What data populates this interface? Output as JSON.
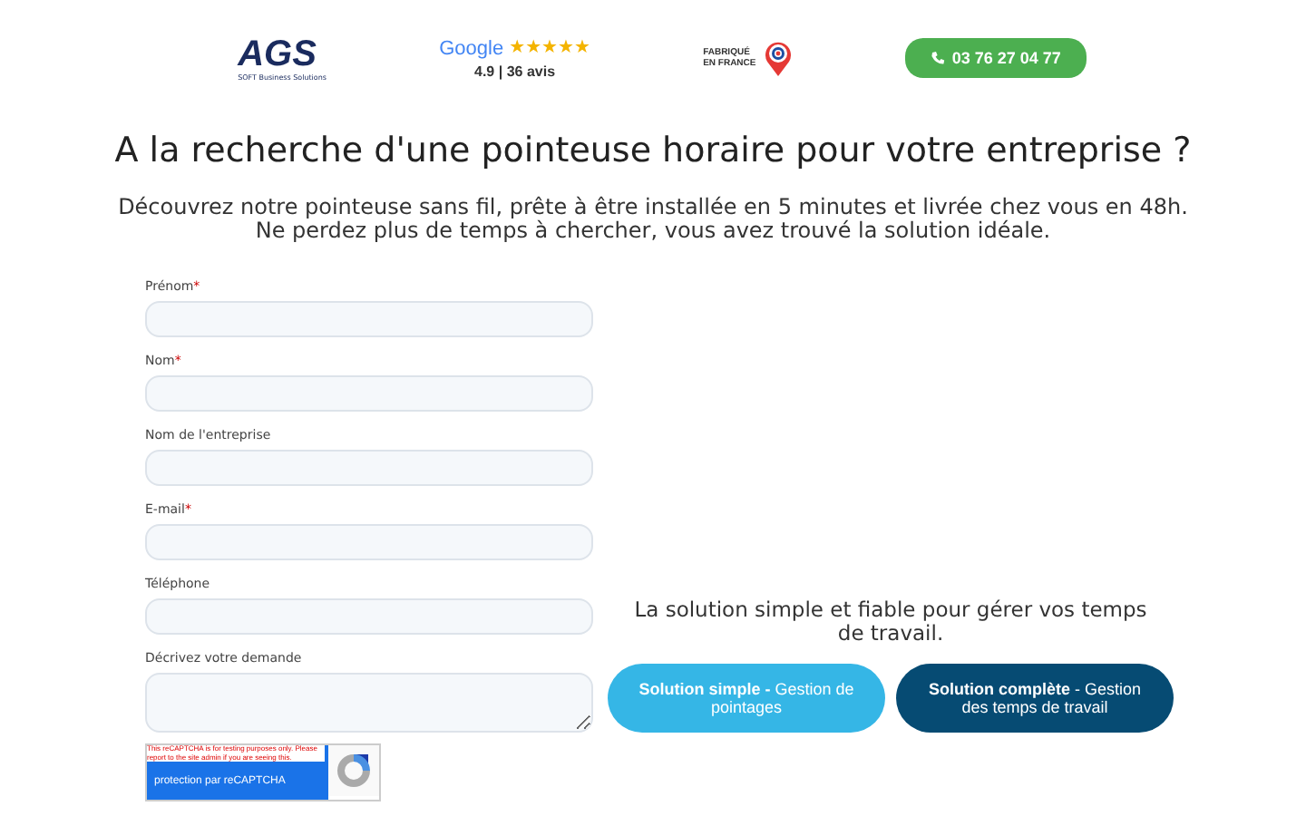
{
  "header": {
    "logo": {
      "name": "AGS",
      "tagline": "SOFT Business Solutions"
    },
    "rating": {
      "brand": "Google",
      "stars": 5,
      "score": "4.9",
      "separator": "|",
      "reviews": "36 avis"
    },
    "made_in": {
      "line1": "FABRIQUÉ",
      "line2": "EN FRANCE"
    },
    "phone_button": "03 76 27 04 77"
  },
  "title": "A la recherche d'une pointeuse horaire pour votre entreprise ?",
  "subtitle": [
    "Découvrez notre pointeuse sans fil, prête à être installée en 5 minutes et livrée chez vous en 48h.",
    "Ne perdez plus de temps à chercher, vous avez trouvé la solution idéale."
  ],
  "form": {
    "fields": [
      {
        "label": "Prénom",
        "required_mark": "*",
        "kind": "input"
      },
      {
        "label": "Nom",
        "required_mark": "*",
        "kind": "input"
      },
      {
        "label": "Nom de l'entreprise",
        "kind": "input"
      },
      {
        "label": "E-mail",
        "required_mark": "*",
        "kind": "input"
      },
      {
        "label": "Téléphone",
        "kind": "input"
      },
      {
        "label": "Décrivez votre demande",
        "kind": "textarea"
      }
    ],
    "captcha": {
      "warning": "This reCAPTCHA is for testing purposes only. Please report to the site admin if you are seeing this.",
      "label": "protection par reCAPTCHA"
    }
  },
  "solutions": {
    "text": "La solution simple et fiable pour gérer vos temps de travail.",
    "buttons": [
      {
        "label": "**Solution simple -** Gestion de pointages",
        "kind": "light"
      },
      {
        "label": "**Solution complète** - Gestion des temps de travail",
        "kind": "dark"
      }
    ]
  }
}
